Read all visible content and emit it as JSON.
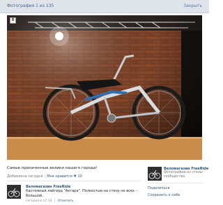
{
  "header": {
    "counter": "Фотография 1 из 135",
    "close_label": "Закрыть"
  },
  "photo": {
    "badge": "8"
  },
  "caption": "Самые прокаченные велики нашего города!",
  "meta": {
    "added": "Добавлена сегодня",
    "like_label": "Мне нравится",
    "like_count": "10",
    "heart": "♥"
  },
  "comment": {
    "author": "Веломагазин FreeRide",
    "text": "Кастомный лайгерд \"Актара\". Полностью на стену не всех - большой.",
    "time": "сегодня в 17:14",
    "reply_label": "Ответить"
  },
  "sidebar": {
    "title": "Веломагазин FreeRide",
    "subtitle": "Фотографии из стены сообщества",
    "share": "Поделиться",
    "save": "Сохранить к себе"
  },
  "colors": {
    "link": "#2b587a",
    "header_bg": "#dfe4ea"
  }
}
